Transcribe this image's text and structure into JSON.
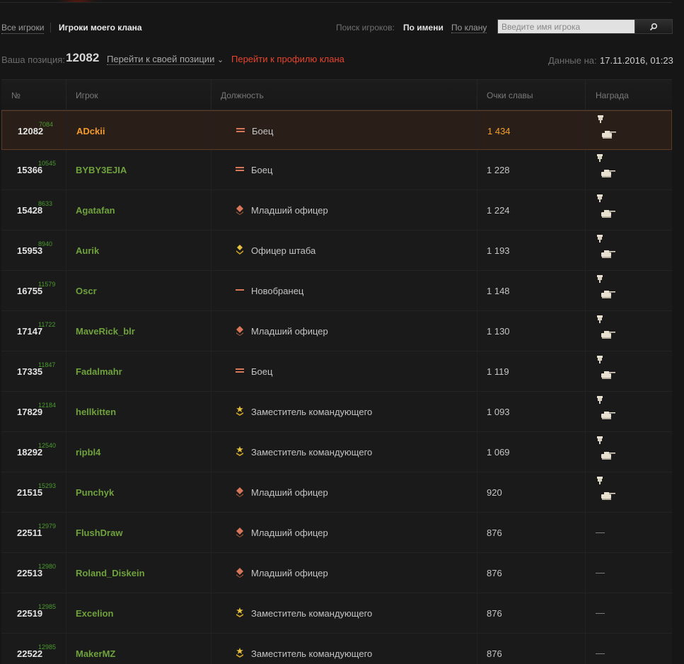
{
  "filters": {
    "all_players": "Все игроки",
    "clan_players": "Игроки моего клана",
    "search_label": "Поиск игроков:",
    "by_name": "По имени",
    "by_clan": "По клану",
    "search_placeholder": "Введите имя игрока"
  },
  "position": {
    "label": "Ваша позиция:",
    "value": "12082",
    "goto_own": "Перейти к своей позиции",
    "goto_clan": "Перейти к профилю клана",
    "data_label": "Данные на:",
    "data_value": "17.11.2016, 01:23"
  },
  "table": {
    "headers": {
      "rank": "№",
      "player": "Игрок",
      "role": "Должность",
      "score": "Очки славы",
      "award": "Награда"
    },
    "rows": [
      {
        "rank": "12082",
        "old": "7084",
        "player": "ADckii",
        "role": "Боец",
        "role_icon": "fighter-icon",
        "score": "1 434",
        "award": true
      },
      {
        "rank": "15366",
        "old": "10545",
        "player": "BYBY3EJIA",
        "role": "Боец",
        "role_icon": "fighter-icon",
        "score": "1 228",
        "award": true
      },
      {
        "rank": "15428",
        "old": "8633",
        "player": "Agatafan",
        "role": "Младший офицер",
        "role_icon": "junior-officer-icon",
        "score": "1 224",
        "award": true
      },
      {
        "rank": "15953",
        "old": "8940",
        "player": "Aurik",
        "role": "Офицер штаба",
        "role_icon": "staff-officer-icon",
        "score": "1 193",
        "award": true
      },
      {
        "rank": "16755",
        "old": "11579",
        "player": "Oscr",
        "role": "Новобранец",
        "role_icon": "recruit-icon",
        "score": "1 148",
        "award": true
      },
      {
        "rank": "17147",
        "old": "11722",
        "player": "MaveRick_blr",
        "role": "Младший офицер",
        "role_icon": "junior-officer-icon",
        "score": "1 130",
        "award": true
      },
      {
        "rank": "17335",
        "old": "11847",
        "player": "Fadalmahr",
        "role": "Боец",
        "role_icon": "fighter-icon",
        "score": "1 119",
        "award": true
      },
      {
        "rank": "17829",
        "old": "12184",
        "player": "hellkitten",
        "role": "Заместитель командующего",
        "role_icon": "deputy-commander-icon",
        "score": "1 093",
        "award": true
      },
      {
        "rank": "18292",
        "old": "12540",
        "player": "ripbl4",
        "role": "Заместитель командующего",
        "role_icon": "deputy-commander-icon",
        "score": "1 069",
        "award": true
      },
      {
        "rank": "21515",
        "old": "15293",
        "player": "Punchyk",
        "role": "Младший офицер",
        "role_icon": "junior-officer-icon",
        "score": "920",
        "award": true
      },
      {
        "rank": "22511",
        "old": "12979",
        "player": "FlushDraw",
        "role": "Младший офицер",
        "role_icon": "junior-officer-icon",
        "score": "876",
        "award": false
      },
      {
        "rank": "22513",
        "old": "12980",
        "player": "Roland_Diskein",
        "role": "Младший офицер",
        "role_icon": "junior-officer-icon",
        "score": "876",
        "award": false
      },
      {
        "rank": "22519",
        "old": "12985",
        "player": "Excelion",
        "role": "Заместитель командующего",
        "role_icon": "deputy-commander-icon",
        "score": "876",
        "award": false
      },
      {
        "rank": "22522",
        "old": "12985",
        "player": "MakerMZ",
        "role": "Заместитель командующего",
        "role_icon": "deputy-commander-icon",
        "score": "876",
        "award": false
      }
    ],
    "no_award": "—"
  }
}
